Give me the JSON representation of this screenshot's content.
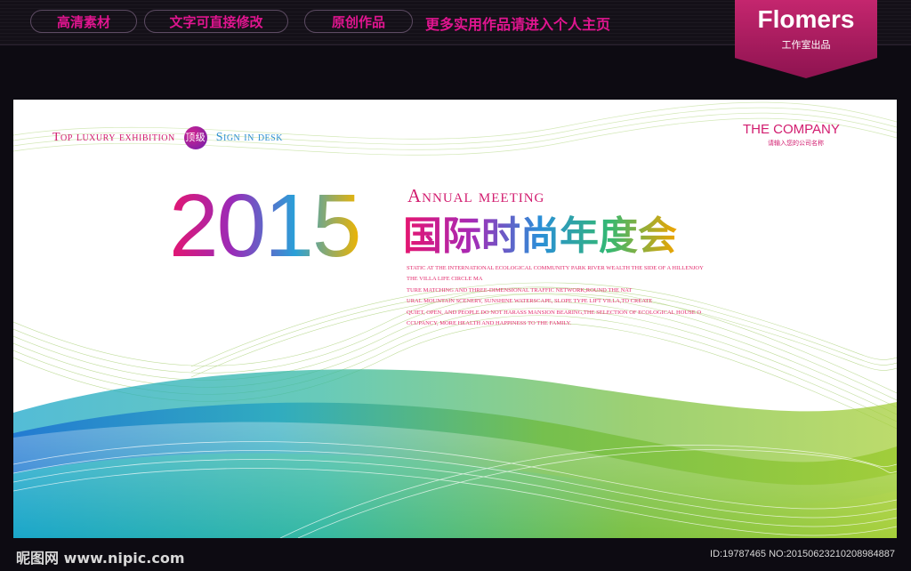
{
  "topbar": {
    "tags": [
      "高清素材",
      "文字可直接修改",
      "原创作品"
    ],
    "promo": "更多实用作品请进入个人主页",
    "logo_title": "Flomers",
    "logo_sub": "工作室出品"
  },
  "banner": {
    "tagline_left": "Top luxury exhibition",
    "tagline_badge": "顶级",
    "tagline_right": "Sign in desk",
    "company": "THE COMPANY",
    "company_sub": "请输入您的公司名称",
    "year": "2015",
    "annual": "Annual meeting",
    "cn_title": "国际时尚年度会",
    "desc_lines": [
      "STATIC AT THE INTERNATIONAL ECOLOGICAL COMMUNITY PARK RIVER WEALTH THE SIDE OF A HILLENJOY",
      "THE VILLA LIFE CIRCLE MA",
      "TURE MATCHING AND THREE-DIMENSIONAL TRAFFIC NETWORK,ROUND THE NAT",
      "URAL MOUNTAIN SCENERY, SUNSHINE WATERSCAPE, SLOPE TYPE LIFT VILLA,TO CREATE",
      "QUIET, OPEN, AND PEOPLE DO NOT HARASS MANSION BEARING,THE SELECTION OF ECOLOGICAL HOUSE O",
      "CCUPANCY, MORE HEALTH AND HAPPINESS TO THE FAMILY."
    ]
  },
  "footer": {
    "watermark": "昵图网 www.nipic.com",
    "image_id": "ID:19787465 NO:20150623210208984887"
  },
  "colors": {
    "magenta": "#e0158f",
    "pink": "#e22a6c",
    "purple": "#6b1fae",
    "teal": "#1aa6c9",
    "green": "#8cc43e",
    "yellow": "#f0c000"
  }
}
